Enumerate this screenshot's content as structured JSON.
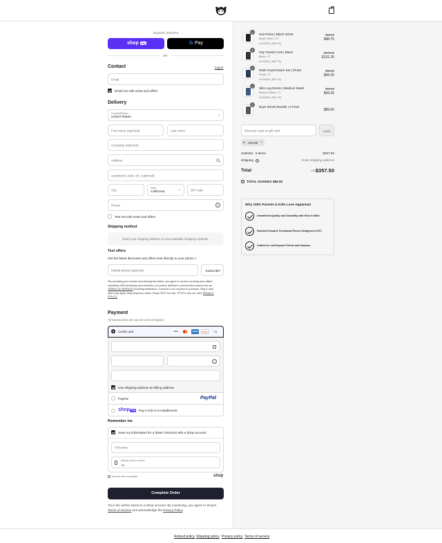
{
  "header": {
    "logo_icon": "monkey-logo-icon",
    "cart_icon": "shopping-bag-icon"
  },
  "express": {
    "title": "Express checkout",
    "shop_label": "shop",
    "shop_pay_badge": "Pay",
    "gpay_label": "Pay",
    "or_label": "OR"
  },
  "contact": {
    "title": "Contact",
    "login_label": "Log in",
    "email_placeholder": "Email",
    "news_label": "Email me with news and offers"
  },
  "delivery": {
    "title": "Delivery",
    "country_label": "Country/Region",
    "country_value": "United States",
    "first_name": "First name (optional)",
    "last_name": "Last name",
    "company": "Company (optional)",
    "address": "Address",
    "apartment": "Apartment, suite, etc. (optional)",
    "city": "City",
    "state_label": "State",
    "state_value": "California",
    "zip": "ZIP code",
    "phone": "Phone",
    "text_news": "Text me with news and offers"
  },
  "shipping_method": {
    "title": "Shipping method",
    "notice": "Enter your shipping address to view available shipping methods."
  },
  "text_offers": {
    "title": "Text offers",
    "subtitle": "Get the latest discounts and offers sent directly to your phone >",
    "mobile_placeholder": "Mobile phone (optional)",
    "subscribe_label": "Subscribe*",
    "disclaimer_1": "*By providing your number and clicking the button, you agree to receive recurring auto-dialed",
    "disclaimer_2": "marketing SMS (including cart reminders, AI content, artificial or prerecorded voices) and our",
    "disclaimer_3a": "TERMS OF SERVICE",
    "disclaimer_3b": " (including arbitration). Consent is not required to purchase. Msg & data",
    "disclaimer_4a": "rates may apply. Msg frequency varies. Reply HELP for help, STOP to opt-out. View ",
    "disclaimer_4b": "PRIVACY",
    "disclaimer_5": "POLICY."
  },
  "payment": {
    "title": "Payment",
    "subtitle": "All transactions are secure and encrypted.",
    "credit_card_label": "Credit card",
    "cards": [
      "VISA",
      "MC",
      "AMEX",
      "DISC"
    ],
    "more_cards": "+4",
    "billing_same_label": "Use shipping address as billing address",
    "paypal_label": "PayPal",
    "paypal_logo": "PayPal",
    "shoppay_logo": "shop",
    "shoppay_badge": "Pay",
    "shoppay_label": "Pay in full or in installments"
  },
  "remember": {
    "title": "Remember me",
    "save_label": "Save my information for a faster checkout with a Shop account",
    "full_name": "Full name",
    "mobile_label": "Mobile phone number",
    "mobile_prefix": "+1",
    "secure_label": "Secure and encrypted",
    "shop_logo": "shop"
  },
  "complete_button": "Complete Order",
  "legal": {
    "line1": "Your info will be saved to a Shop account. By continuing, you agree to Shop's",
    "terms": "Terms of Service",
    "and": " and acknowledge the ",
    "privacy": "Privacy Policy",
    "end": "."
  },
  "order": {
    "items": [
      {
        "name": "Suit Pants | Black Velvet",
        "variant": "Black Velvet / 27",
        "discount": "USA25 (-$16.25)",
        "orig": "$65.00",
        "price": "$48.75",
        "qty": "1"
      },
      {
        "name": "City Transit Coat | Black",
        "variant": "Black / 27",
        "discount": "USA25 (-$43.75)",
        "orig": "$175.00",
        "price": "$131.25",
        "qty": "1"
      },
      {
        "name": "Rash Guard Swim Set | Pirate",
        "variant": "Pirate / 27",
        "discount": "USA25 (-$14.75)",
        "orig": "$59.00",
        "price": "$44.25",
        "qty": "1"
      },
      {
        "name": "Slim Leg Denim | Medium Wash",
        "variant": "Medium Wash / 17",
        "discount": "USA25 (-$14.75)",
        "orig": "$59.00",
        "price": "$44.25",
        "qty": "1"
      },
      {
        "name": "Boys Shorts Bundle | 4-Pack",
        "variant": "",
        "discount": "",
        "orig": "",
        "price": "$89.00",
        "qty": "1"
      }
    ],
    "discount_placeholder": "Discount code or gift card",
    "apply_label": "Apply",
    "applied_code": "USA25",
    "subtotal_label": "Subtotal · 5 items",
    "subtotal_value": "$357.50",
    "shipping_label": "Shipping",
    "shipping_value": "Enter shipping address",
    "total_label": "Total",
    "currency": "USD",
    "total_value": "$357.50",
    "savings_label": "TOTAL SAVINGS",
    "savings_value": "$89.50"
  },
  "why": {
    "title": "Why 100K Parents & Kids Love Appaman!",
    "items": [
      "Unmatched Quality and Durability with Kids in Mind",
      "Fashion-Forward, Functional Pieces Designed in NYC",
      "Crafted to Last Beyond Trends and Seasons"
    ]
  },
  "footer": {
    "links": [
      "Refund policy",
      "Shipping policy",
      "Privacy policy",
      "Terms of service"
    ]
  }
}
